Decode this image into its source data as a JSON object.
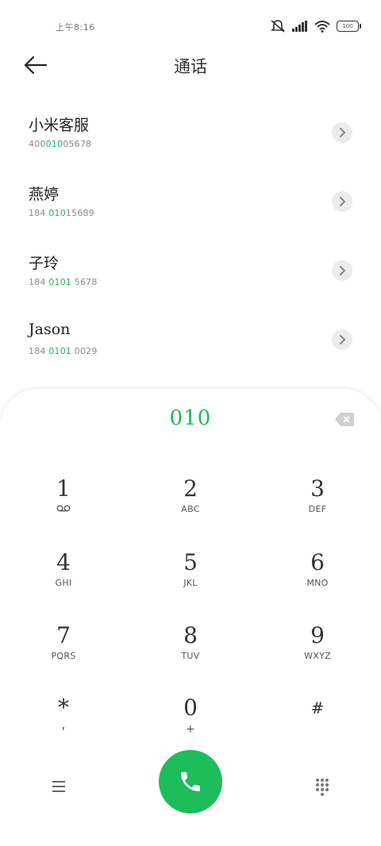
{
  "status_bar": {
    "time": "上午8:16",
    "battery": "100"
  },
  "header": {
    "title": "通话"
  },
  "contacts": [
    {
      "name": "小米客服",
      "number_pre": "400",
      "number_hl": "010",
      "number_post": "05678"
    },
    {
      "name": "燕婷",
      "number_pre": "184 ",
      "number_hl": "010",
      "number_post": "15689"
    },
    {
      "name": "子玲",
      "number_pre": "184 ",
      "number_hl": "0101",
      "number_post": " 5678"
    },
    {
      "name": "Jason",
      "number_pre": "184 ",
      "number_hl": "0101",
      "number_post": " 0029"
    }
  ],
  "dialpad": {
    "input": "010",
    "keys": [
      {
        "digit": "1",
        "letters": "voicemail-icon"
      },
      {
        "digit": "2",
        "letters": "ABC"
      },
      {
        "digit": "3",
        "letters": "DEF"
      },
      {
        "digit": "4",
        "letters": "GHI"
      },
      {
        "digit": "5",
        "letters": "JKL"
      },
      {
        "digit": "6",
        "letters": "MNO"
      },
      {
        "digit": "7",
        "letters": "PQRS"
      },
      {
        "digit": "8",
        "letters": "TUV"
      },
      {
        "digit": "9",
        "letters": "WXYZ"
      },
      {
        "digit": "*",
        "letters": ","
      },
      {
        "digit": "0",
        "letters": "+"
      },
      {
        "digit": "#",
        "letters": ""
      }
    ]
  },
  "colors": {
    "accent": "#19b955",
    "call_button": "#1cbd5a"
  },
  "icons": {
    "back": "back-arrow-icon",
    "chevron": "chevron-right-icon",
    "backspace": "backspace-icon",
    "menu": "menu-icon",
    "call": "phone-icon",
    "dialpad": "dialpad-grid-icon"
  }
}
